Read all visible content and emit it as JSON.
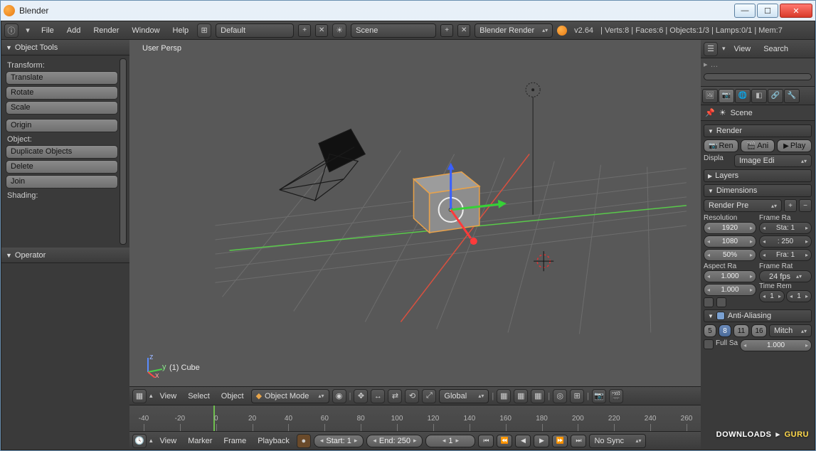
{
  "window": {
    "title": "Blender"
  },
  "topbar": {
    "menus": [
      "File",
      "Add",
      "Render",
      "Window",
      "Help"
    ],
    "layout": "Default",
    "scene": "Scene",
    "engine": "Blender Render",
    "version": "v2.64",
    "stats": "Verts:8 | Faces:6 | Objects:1/3 | Lamps:0/1 | Mem:7"
  },
  "toolshelf": {
    "title": "Object Tools",
    "transform_label": "Transform:",
    "translate": "Translate",
    "rotate": "Rotate",
    "scale": "Scale",
    "origin": "Origin",
    "object_label": "Object:",
    "duplicate": "Duplicate Objects",
    "delete": "Delete",
    "join": "Join",
    "shading_label": "Shading:",
    "operator": "Operator"
  },
  "viewport": {
    "persp_label": "User Persp",
    "object_label": "(1) Cube",
    "header": {
      "view": "View",
      "select": "Select",
      "object": "Object",
      "mode": "Object Mode",
      "orientation": "Global"
    }
  },
  "timeline": {
    "ticks": [
      -40,
      -20,
      0,
      20,
      40,
      60,
      80,
      100,
      120,
      140,
      160,
      180,
      200,
      220,
      240,
      260
    ],
    "menus": {
      "view": "View",
      "marker": "Marker",
      "frame": "Frame",
      "playback": "Playback"
    },
    "start": "Start: 1",
    "end": "End: 250",
    "current": "1",
    "sync": "No Sync"
  },
  "outliner": {
    "view": "View",
    "search": "Search"
  },
  "properties": {
    "crumb": "Scene",
    "render_hdr": "Render",
    "render_btn": "Ren",
    "anim_btn": "Ani",
    "play_btn": "Play",
    "display_label": "Displa",
    "display_value": "Image Edi",
    "layers_hdr": "Layers",
    "dimensions_hdr": "Dimensions",
    "preset": "Render Pre",
    "res_label": "Resolution",
    "frame_range_label": "Frame Ra",
    "res_x": "1920",
    "res_y": "1080",
    "res_pct": "50%",
    "frame_start": "Sta: 1",
    "frame_end": ": 250",
    "frame_step": "Fra: 1",
    "aspect_label": "Aspect Ra",
    "frame_rate_label": "Frame Rat",
    "aspect_x": "1.000",
    "fps": "24 fps",
    "aspect_y": "1.000",
    "time_remap": "Time Rem",
    "tr_old": "1",
    "tr_new": "1",
    "aa_hdr": "Anti-Aliasing",
    "aa_5": "5",
    "aa_8": "8",
    "aa_11": "11",
    "aa_16": "16",
    "aa_filter": "Mitch",
    "fullsample": "Full Sa",
    "aa_size": "1.000"
  },
  "watermark": {
    "a": "DOWNLOADS",
    "b": "GURU"
  }
}
